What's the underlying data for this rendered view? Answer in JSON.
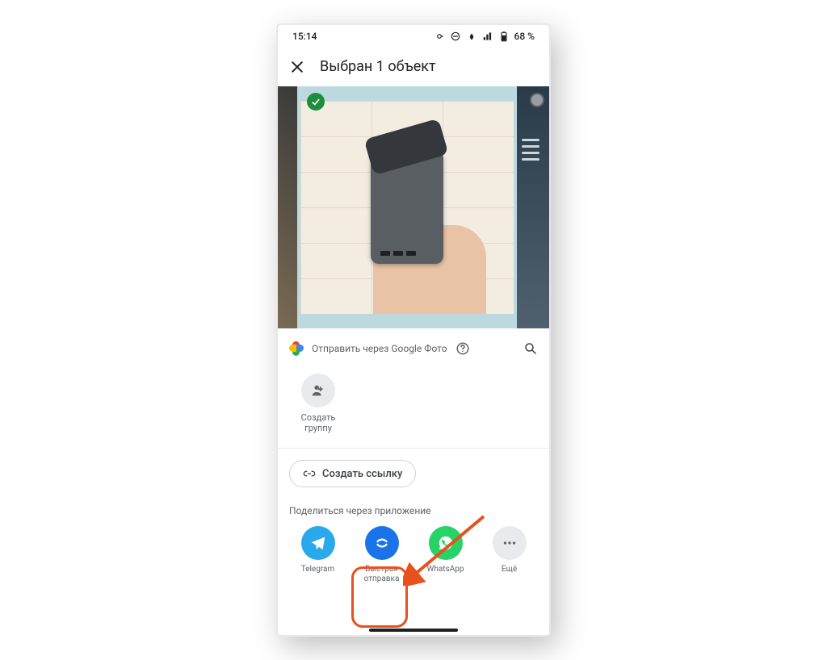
{
  "status": {
    "time": "15:14",
    "battery": "68 %"
  },
  "header": {
    "title": "Выбран 1 объект"
  },
  "share": {
    "google_photos_label": "Отправить через Google Фото",
    "create_group": "Создать группу",
    "create_link": "Создать ссылку",
    "section_label": "Поделиться через приложение",
    "apps": {
      "telegram": "Telegram",
      "nearby": "Быстрая отправка",
      "whatsapp": "WhatsApp",
      "more": "Ещё"
    }
  }
}
